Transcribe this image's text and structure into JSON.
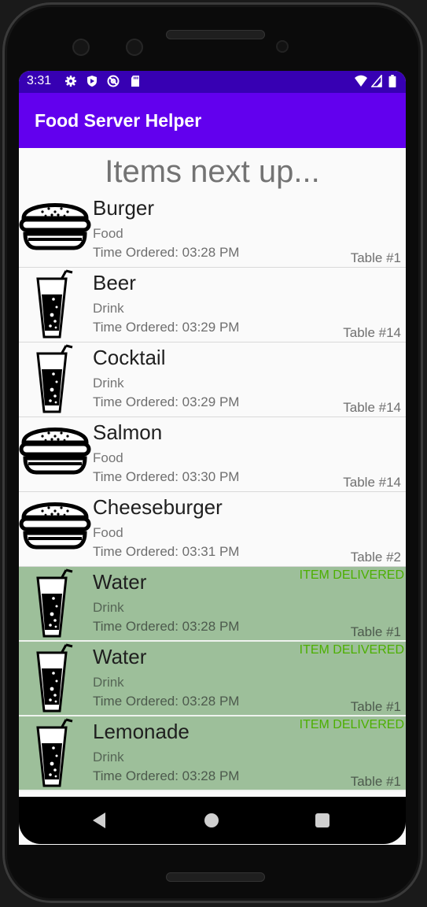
{
  "status_bar": {
    "time": "3:31",
    "left_icons": [
      "gear-icon",
      "shield-icon",
      "at-sign-icon",
      "sd-card-icon"
    ],
    "right_icons": [
      "wifi-icon",
      "signal-icon",
      "battery-icon"
    ]
  },
  "app_bar": {
    "title": "Food Server Helper",
    "color": "#6200ee"
  },
  "heading": "Items next up...",
  "items": [
    {
      "name": "Burger",
      "type": "Food",
      "time": "Time Ordered: 03:28 PM",
      "table": "Table #1",
      "icon": "burger-icon",
      "delivered": false
    },
    {
      "name": "Beer",
      "type": "Drink",
      "time": "Time Ordered: 03:29 PM",
      "table": "Table #14",
      "icon": "drink-icon",
      "delivered": false
    },
    {
      "name": "Cocktail",
      "type": "Drink",
      "time": "Time Ordered: 03:29 PM",
      "table": "Table #14",
      "icon": "drink-icon",
      "delivered": false
    },
    {
      "name": "Salmon",
      "type": "Food",
      "time": "Time Ordered: 03:30 PM",
      "table": "Table #14",
      "icon": "burger-icon",
      "delivered": false
    },
    {
      "name": "Cheeseburger",
      "type": "Food",
      "time": "Time Ordered: 03:31 PM",
      "table": "Table #2",
      "icon": "burger-icon",
      "delivered": false
    },
    {
      "name": "Water",
      "type": "Drink",
      "time": "Time Ordered: 03:28 PM",
      "table": "Table #1",
      "icon": "drink-icon",
      "delivered": true,
      "flag": "ITEM DELIVERED"
    },
    {
      "name": "Water",
      "type": "Drink",
      "time": "Time Ordered: 03:28 PM",
      "table": "Table #1",
      "icon": "drink-icon",
      "delivered": true,
      "flag": "ITEM DELIVERED"
    },
    {
      "name": "Lemonade",
      "type": "Drink",
      "time": "Time Ordered: 03:28 PM",
      "table": "Table #1",
      "icon": "drink-icon",
      "delivered": true,
      "flag": "ITEM DELIVERED"
    }
  ],
  "nav_bar": {
    "buttons": [
      "back-icon",
      "home-icon",
      "recents-icon"
    ]
  },
  "colors": {
    "status_bar": "#3700b3",
    "delivered_bg": "#9dbf9a",
    "delivered_text": "#4caf00"
  }
}
